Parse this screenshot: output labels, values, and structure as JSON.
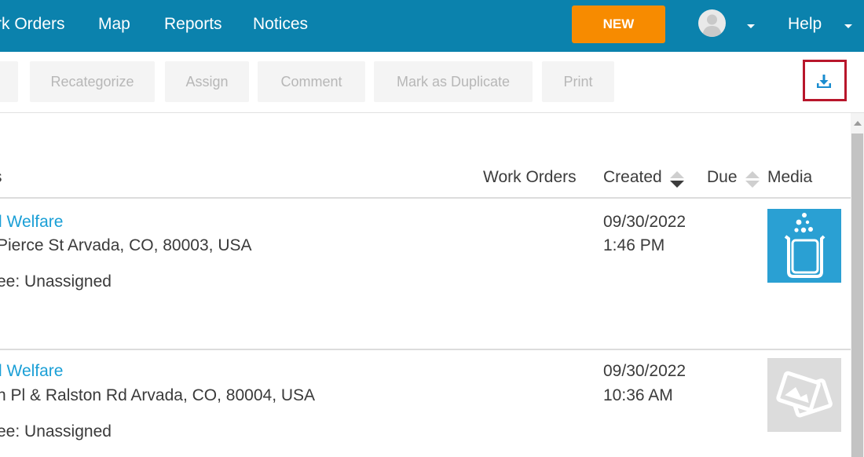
{
  "topnav": {
    "items": [
      "rk Orders",
      "Map",
      "Reports",
      "Notices"
    ],
    "new_button": "NEW",
    "help": "Help"
  },
  "toolbar": {
    "buttons": [
      "Recategorize",
      "Assign",
      "Comment",
      "Mark as Duplicate",
      "Print"
    ],
    "export_icon": "download-icon"
  },
  "table": {
    "headers": {
      "first": "s",
      "work_orders": "Work Orders",
      "created": "Created",
      "due": "Due",
      "media": "Media"
    },
    "rows": [
      {
        "category": "l Welfare",
        "address": "Pierce St Arvada, CO, 80003, USA",
        "assignee": "ee: Unassigned",
        "created_date": "09/30/2022",
        "created_time": "1:46 PM",
        "media": "beaker-icon"
      },
      {
        "category": "l Welfare",
        "address": "n Pl & Ralston Rd Arvada, CO, 80004, USA",
        "assignee": "ee: Unassigned",
        "created_date": "09/30/2022",
        "created_time": "10:36 AM",
        "media": "photos-placeholder-icon"
      }
    ]
  },
  "colors": {
    "header_bg": "#0b82ad",
    "new_button": "#f78b00",
    "link": "#1a9fd6",
    "export_highlight": "#b8162b"
  }
}
